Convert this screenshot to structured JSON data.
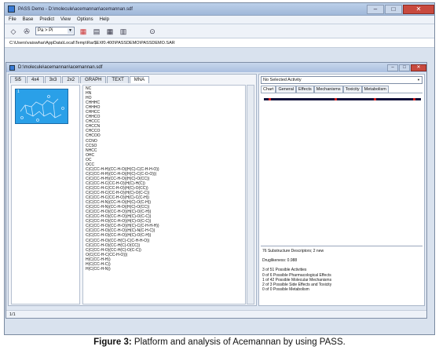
{
  "window": {
    "title": "PASS Demo - D:\\molecule\\acemannan\\acemannan.sdf"
  },
  "menu": [
    "File",
    "Base",
    "Predict",
    "View",
    "Options",
    "Help"
  ],
  "toolbar": {
    "pa_select": "Pa > Pi"
  },
  "path": "C:\\Users\\vaiswhar\\AppData\\Local\\Temp\\Rar$EXf0.400\\PASSDEMO\\PASSDEMO.SAR",
  "child_window": {
    "title": "D:\\molecule\\acemannan\\acemannan.sdf"
  },
  "left_tabs": [
    "5i5",
    "4x4",
    "3x3",
    "2x2",
    "GRAPH",
    "TEXT",
    "MNA"
  ],
  "thumb_label": "1",
  "mna_list": [
    "NC",
    "HN",
    "HO",
    "CHHHC",
    "CHHHO",
    "CHHCC",
    "CHHCO",
    "CHCCC",
    "CHCCN",
    "CHCCO",
    "CHCOO",
    "CCNO",
    "CCSO",
    "NHCC",
    "OHC",
    "OC",
    "OCC",
    "C(C(CC-H-H)(CC-H-O)(H(C)-C(C-H-H-O))",
    "C(C(CC-H-H)(CC-H-O)(H(C)-C(C-O-O)))",
    "C(C(CC-H-H)(CC-H-O)(H(C)-O(CC))",
    "C(C(CC-H-C(CC-H-O)(H(C)-H(C))",
    "C(C(CC-H-C(CC-H-O)(H(C)-O(CC))",
    "C(C(CC-H-C(CC-H-O)(H(C)-O(C-C))",
    "C(C(CC-H-C(CC-H-O)(H(C)-C(C-H))",
    "C(C(CC-H-N)(CC-H-O)(H(C)-O(C-H))",
    "C(C(CC-H-N)(CC-H-O)(H(C)-O(CC))",
    "C(C(CC-H-O)(CC-H-O)(H(C)-O(C-H))",
    "C(C(CC-H-O)(CC-H-O)(H(C)-O(C-C))",
    "C(C(CC-H-O)(CC-H-O)(H(C)-O(C-C))",
    "C(C(CC-H-O)(CC-H-O)(H(C)-C(C-H-H-H))",
    "C(C(CC-H-O)(CC-H-O)(H(C)-N(C-H-C))",
    "C(C(CC-H-O)(CC-H-O)(H(C)-O(C-H))",
    "C(C(CC-H-O)(CC-H(C)-C(C-H-H-O))",
    "C(C(CC-H-O)(CC-H(C)-O(CC))",
    "C(C(CC-H-O)(CC-H(C)-O(C-C))",
    "O(C(CC-H-C(CC-H-O)))",
    "H(C(CC-H-H))",
    "H(C(CC-H-C))",
    "H(C(CC-H-N))"
  ],
  "activity_select": "No Selected Activity",
  "right_tabs": [
    "Chart",
    "General",
    "Effects",
    "Mechanisms",
    "Toxicity",
    "Metabolism"
  ],
  "info": {
    "line1": "76 Substructure Descriptors; 2 new",
    "line2": "Druglikeness: 0.988",
    "lines": [
      "3 of 51 Possible Activities",
      "0 of 6 Possible Pharmacological Effects",
      "1 of 42 Possible Molecular Mechanisms",
      "2 of 3 Possible Side Effects and Toxicity",
      "0 of 0 Possible Metabolism"
    ]
  },
  "status": "1/1",
  "caption": {
    "bold": "Figure 3:",
    "text": " Platform and analysis of Acemannan by using PASS."
  },
  "colors": {
    "thumb": "#2aa0e8",
    "chart_bar": "#12123a",
    "chart_mark": "#d02020"
  }
}
